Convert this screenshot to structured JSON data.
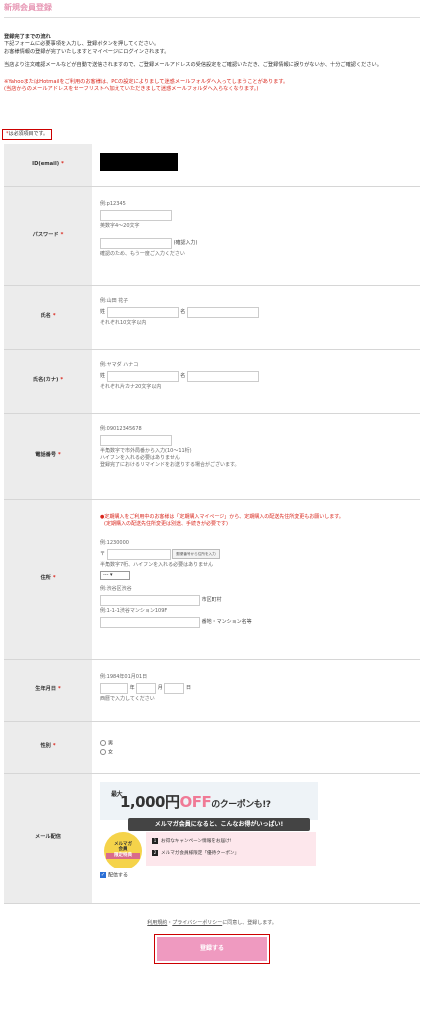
{
  "page": {
    "title": "新規会員登録"
  },
  "intro": {
    "heading": "登録完了までの流れ",
    "line1": "下記フォームに必要事項を入力し、登録ボタンを押してください。",
    "line2": "お客様情報の登録が完了いたしますとマイページにログインされます。",
    "line3": "当店より注文確認メールなどが自動で送信されますので、ご登録メールアドレスの受信設定をご確認いただき、ご登録情報に誤りがないか、十分ご確認ください。",
    "warn1": "※YahooまたはHotmailをご利用のお客様は、PCの設定によりまして迷惑メールフォルダへ入ってしまうことがあります。",
    "warn2": "(当店からのメールアドレスをセーフリストへ加えていただきまして迷惑メールフォルダへ入らなくなります。)"
  },
  "required_note": {
    "star": "*",
    "text": "は必須項目です。"
  },
  "fields": {
    "email": {
      "label": "ID(email)",
      "star": "*"
    },
    "password": {
      "label": "パスワード",
      "star": "*",
      "example": "例:p12345",
      "hint": "英数字4〜20文字",
      "confirm_label": "(確認入力)",
      "confirm_hint": "確認のため、もう一度ご入力ください"
    },
    "name": {
      "label": "氏名",
      "star": "*",
      "example": "例:山田 花子",
      "last": "姓",
      "first": "名",
      "hint": "それぞれ10文字以内"
    },
    "kana": {
      "label": "氏名(カナ)",
      "star": "*",
      "example": "例:ヤマダ ハナコ",
      "last": "姓",
      "first": "名",
      "hint": "それぞれ片カナ20文字以内"
    },
    "phone": {
      "label": "電話番号",
      "star": "*",
      "example": "例:09012345678",
      "hint1": "半角数字で市外局番から入力(10〜11桁)",
      "hint2": "ハイフンを入れる必要はありません",
      "hint3": "登録完了におけるリマインドをお送りする場合がございます。"
    },
    "address": {
      "label": "住所",
      "star": "*",
      "notice1": "●定期購入をご利用中のお客様は「定期購入マイページ」から、定期購入の配送先住所変更もお願いします。",
      "notice2": "(定期購入の配送先住所変更は別途、手続きが必要です)",
      "zip_example": "例:1230000",
      "zip_mark": "〒",
      "zip_button": "郵便番号から住所を入力",
      "zip_hint": "半角数字7桁、ハイフンを入れる必要はありません",
      "pref_value": "---",
      "city_example": "例:渋谷区渋谷",
      "city_label": "市区町村",
      "street_example": "例:1-1-1渋谷マンション109F",
      "street_label": "番地・マンション名等"
    },
    "birthday": {
      "label": "生年月日",
      "star": "*",
      "example": "例:1984年01月01日",
      "year": "年",
      "month": "月",
      "day": "日",
      "hint": "西暦で入力してください"
    },
    "gender": {
      "label": "性別",
      "star": "*",
      "options": [
        "男",
        "女"
      ]
    },
    "newsletter": {
      "label": "メール配信",
      "checkbox_label": "配信する"
    }
  },
  "banner": {
    "max": "最大",
    "amount": "1,000円",
    "off": "OFF",
    "suffix": "のクーポンも!?",
    "band": "メルマガ会員になると、こんなお得がいっぱい!",
    "badge_line1": "メルマガ",
    "badge_line2": "会員",
    "badge_line3": "限定特典",
    "item1_num": "1",
    "item1": "お得なキャンペーン情報をお届け!",
    "item2_num": "2",
    "item2": "メルマガ会員様限定「優待クーポン」"
  },
  "terms": {
    "link1": "利用規約",
    "sep": "・",
    "link2": "プライバシーポリシー",
    "tail": "に同意し、登録します。"
  },
  "submit": {
    "label": "登録する"
  }
}
